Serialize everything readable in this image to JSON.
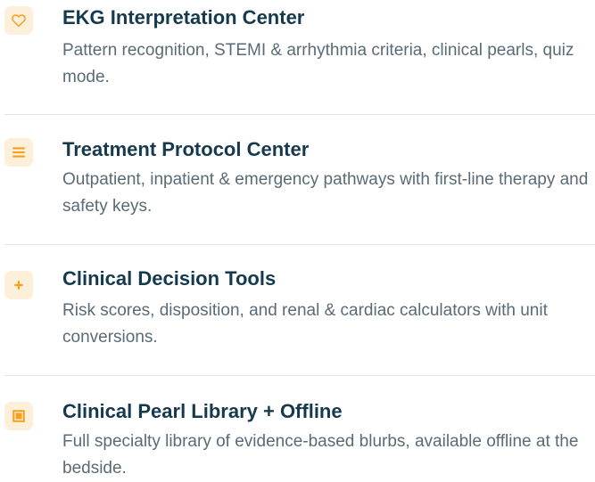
{
  "features": [
    {
      "icon": "heart-icon",
      "title": "EKG Interpretation Center",
      "description": "Pattern recognition, STEMI & arrhythmia criteria, clinical pearls, quiz mode."
    },
    {
      "icon": "menu-icon",
      "title": "Treatment Protocol Center",
      "description": "Outpatient, inpatient & emergency pathways with first-line therapy and safety keys."
    },
    {
      "icon": "plus-icon",
      "title": "Clinical Decision Tools",
      "description": "Risk scores, disposition, and renal & cardiac calculators with unit conversions."
    },
    {
      "icon": "square-icon",
      "title": "Clinical Pearl Library + Offline",
      "description": "Full specialty library of evidence-based blurbs, available offline at the bedside."
    }
  ],
  "colors": {
    "accent": "#f5a01e",
    "icon_bg": "#fdf0da",
    "title": "#163a4d",
    "description": "#5a6b77",
    "divider": "#dfe3e6"
  }
}
